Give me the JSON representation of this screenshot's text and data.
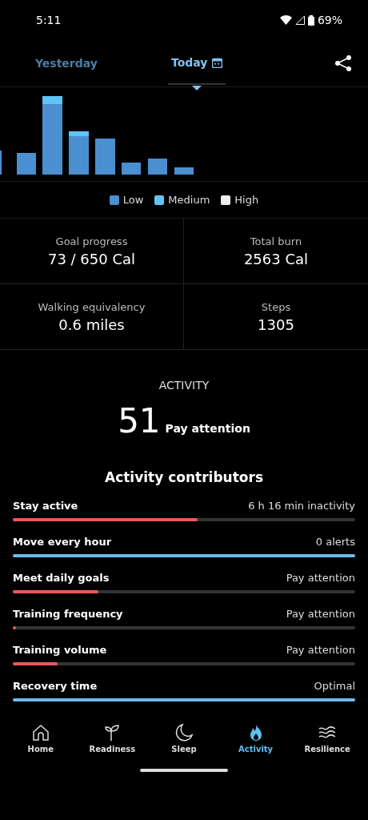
{
  "status_bar": {
    "time": "5:11",
    "battery": "69%"
  },
  "tabs": [
    {
      "label": "Yesterday",
      "selected": false
    },
    {
      "label": "Today",
      "selected": true
    }
  ],
  "legend": [
    {
      "label": "Low",
      "color": "#4a8fcf"
    },
    {
      "label": "Medium",
      "color": "#5ec4f5"
    },
    {
      "label": "High",
      "color": "#eeeeee"
    }
  ],
  "stats": [
    {
      "label": "Goal progress",
      "value": "73 / 650 Cal"
    },
    {
      "label": "Total burn",
      "value": "2563 Cal"
    },
    {
      "label": "Walking equivalency",
      "value": "0.6 miles"
    },
    {
      "label": "Steps",
      "value": "1305"
    }
  ],
  "activity": {
    "title": "ACTIVITY",
    "score": "51",
    "status": "Pay attention"
  },
  "contributors_title": "Activity contributors",
  "contributors": [
    {
      "name": "Stay active",
      "reading": "6 h 16 min inactivity",
      "level": 0.54,
      "color": "#e8595a"
    },
    {
      "name": "Move every hour",
      "reading": "0 alerts",
      "level": 1,
      "color": "#6cb9ec"
    },
    {
      "name": "Meet daily goals",
      "reading": "Pay attention",
      "level": 0.25,
      "color": "#e8595a"
    },
    {
      "name": "Training frequency",
      "reading": "Pay attention",
      "level": 0.01,
      "color": "#e8595a"
    },
    {
      "name": "Training volume",
      "reading": "Pay attention",
      "level": 0.13,
      "color": "#e8595a"
    },
    {
      "name": "Recovery time",
      "reading": "Optimal",
      "level": 1,
      "color": "#6cb9ec"
    }
  ],
  "nav": [
    {
      "label": "Home",
      "kind": "home",
      "selected": false
    },
    {
      "label": "Readiness",
      "kind": "readiness",
      "selected": false
    },
    {
      "label": "Sleep",
      "kind": "sleep",
      "selected": false
    },
    {
      "label": "Activity",
      "kind": "activity",
      "selected": true
    },
    {
      "label": "Resilience",
      "kind": "resilience",
      "selected": false
    }
  ]
}
